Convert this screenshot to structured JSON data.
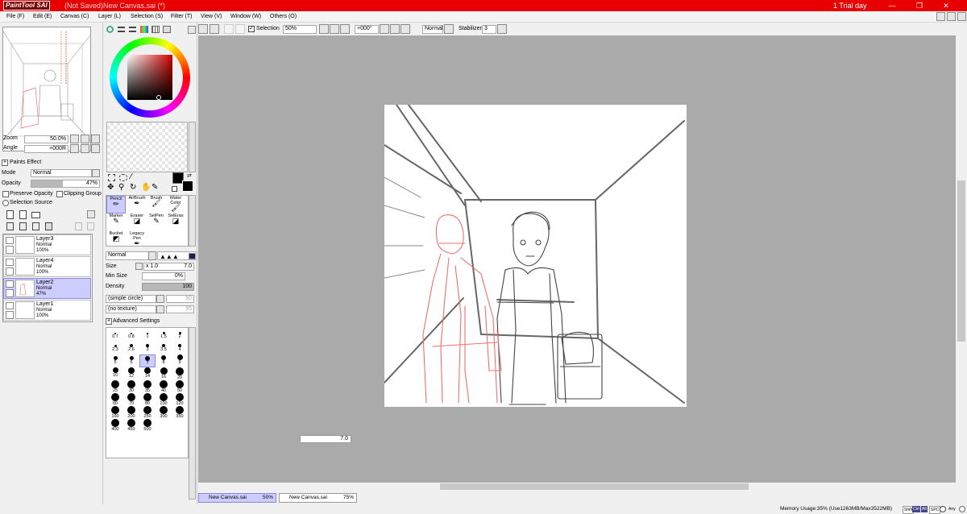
{
  "title_bar": {
    "app_name": "PaintTool SAI",
    "document_title": "(Not Saved)New Canvas.sai (*)",
    "trial_text": "1 Trial day",
    "minimize": "—",
    "restore": "❐",
    "close": "✕"
  },
  "menu": [
    "File (F)",
    "Edit (E)",
    "Canvas (C)",
    "Layer (L)",
    "Selection (S)",
    "Filter (T)",
    "View (V)",
    "Window (W)",
    "Others (O)"
  ],
  "navigator": {
    "zoom_label": "Zoom",
    "zoom_value": "50.0%",
    "angle_label": "Angle",
    "angle_value": "+000R"
  },
  "layer_panel": {
    "paints_effect": "Paints Effect",
    "mode_label": "Mode",
    "mode_value": "Normal",
    "opacity_label": "Opacity",
    "opacity_value": "47%",
    "opacity_fraction": 0.47,
    "preserve_opacity": "Preserve Opacity",
    "clipping_group": "Clipping Group",
    "selection_source": "Selection Source",
    "layers": [
      {
        "name": "Layer3",
        "mode": "Normal",
        "opacity": "100%"
      },
      {
        "name": "Layer4",
        "mode": "Normal",
        "opacity": "100%"
      },
      {
        "name": "Layer2",
        "mode": "Normal",
        "opacity": "47%"
      },
      {
        "name": "Layer1",
        "mode": "Normal",
        "opacity": "100%"
      }
    ]
  },
  "tools": [
    {
      "label": "Pencil",
      "icon": "pencil-icon"
    },
    {
      "label": "AirBrush",
      "icon": "airbrush-icon"
    },
    {
      "label": "Brush",
      "icon": "brush-icon"
    },
    {
      "label": "Water Color",
      "icon": "watercolor-icon"
    },
    {
      "label": "Marker",
      "icon": "marker-icon"
    },
    {
      "label": "Eraser",
      "icon": "eraser-icon"
    },
    {
      "label": "SelPen",
      "icon": "selpen-icon"
    },
    {
      "label": "SelEras",
      "icon": "seleras-icon"
    },
    {
      "label": "Bucket",
      "icon": "bucket-icon"
    },
    {
      "label": "Legacy Pen",
      "icon": "legacy-pen-icon"
    }
  ],
  "brush_settings": {
    "blend_mode": "Normal",
    "size_label": "Size",
    "size_multiplier": "x 1.0",
    "size_value": "7.0",
    "min_size_label": "Min Size",
    "min_size_value": "0%",
    "density_label": "Density",
    "density_value": "100",
    "shape": "(simple circle)",
    "shape_value": "50",
    "texture": "(no texture)",
    "texture_value": "95",
    "advanced": "Advanced Settings",
    "sizes": [
      "0.7",
      "0.8",
      "1",
      "1.5",
      "2",
      "2.3",
      "2.6",
      "3",
      "3.5",
      "4",
      "5",
      "6",
      "7",
      "8",
      "9",
      "10",
      "12",
      "14",
      "16",
      "20",
      "25",
      "30",
      "35",
      "40",
      "50",
      "60",
      "70",
      "80",
      "100",
      "120",
      "160",
      "200",
      "250",
      "300",
      "350",
      "400",
      "450",
      "500"
    ],
    "selected_size": "7"
  },
  "toolbar": {
    "selection_label": "Selection",
    "zoom_value": "50%",
    "rotation_value": "+000°",
    "blend_value": "Normal",
    "stabilizer_label": "Stabilizer",
    "stabilizer_value": "3"
  },
  "brush_size_popup": "7.0",
  "tabs": [
    {
      "name": "New Canvas.sai",
      "zoom": "50%"
    },
    {
      "name": "New Canvas.sai",
      "zoom": "75%"
    }
  ],
  "status": {
    "memory": "Memory Usage:35% (Use1263MB/Max3522MB)",
    "keys": [
      "Shift",
      "Ctrl",
      "Alt",
      "SPC",
      "Any"
    ]
  },
  "colors": {
    "title_bar": "#e80000",
    "selection_highlight": "#ccccff",
    "sketch_red": "#f07070",
    "canvas_bg": "#aaaaaa"
  }
}
